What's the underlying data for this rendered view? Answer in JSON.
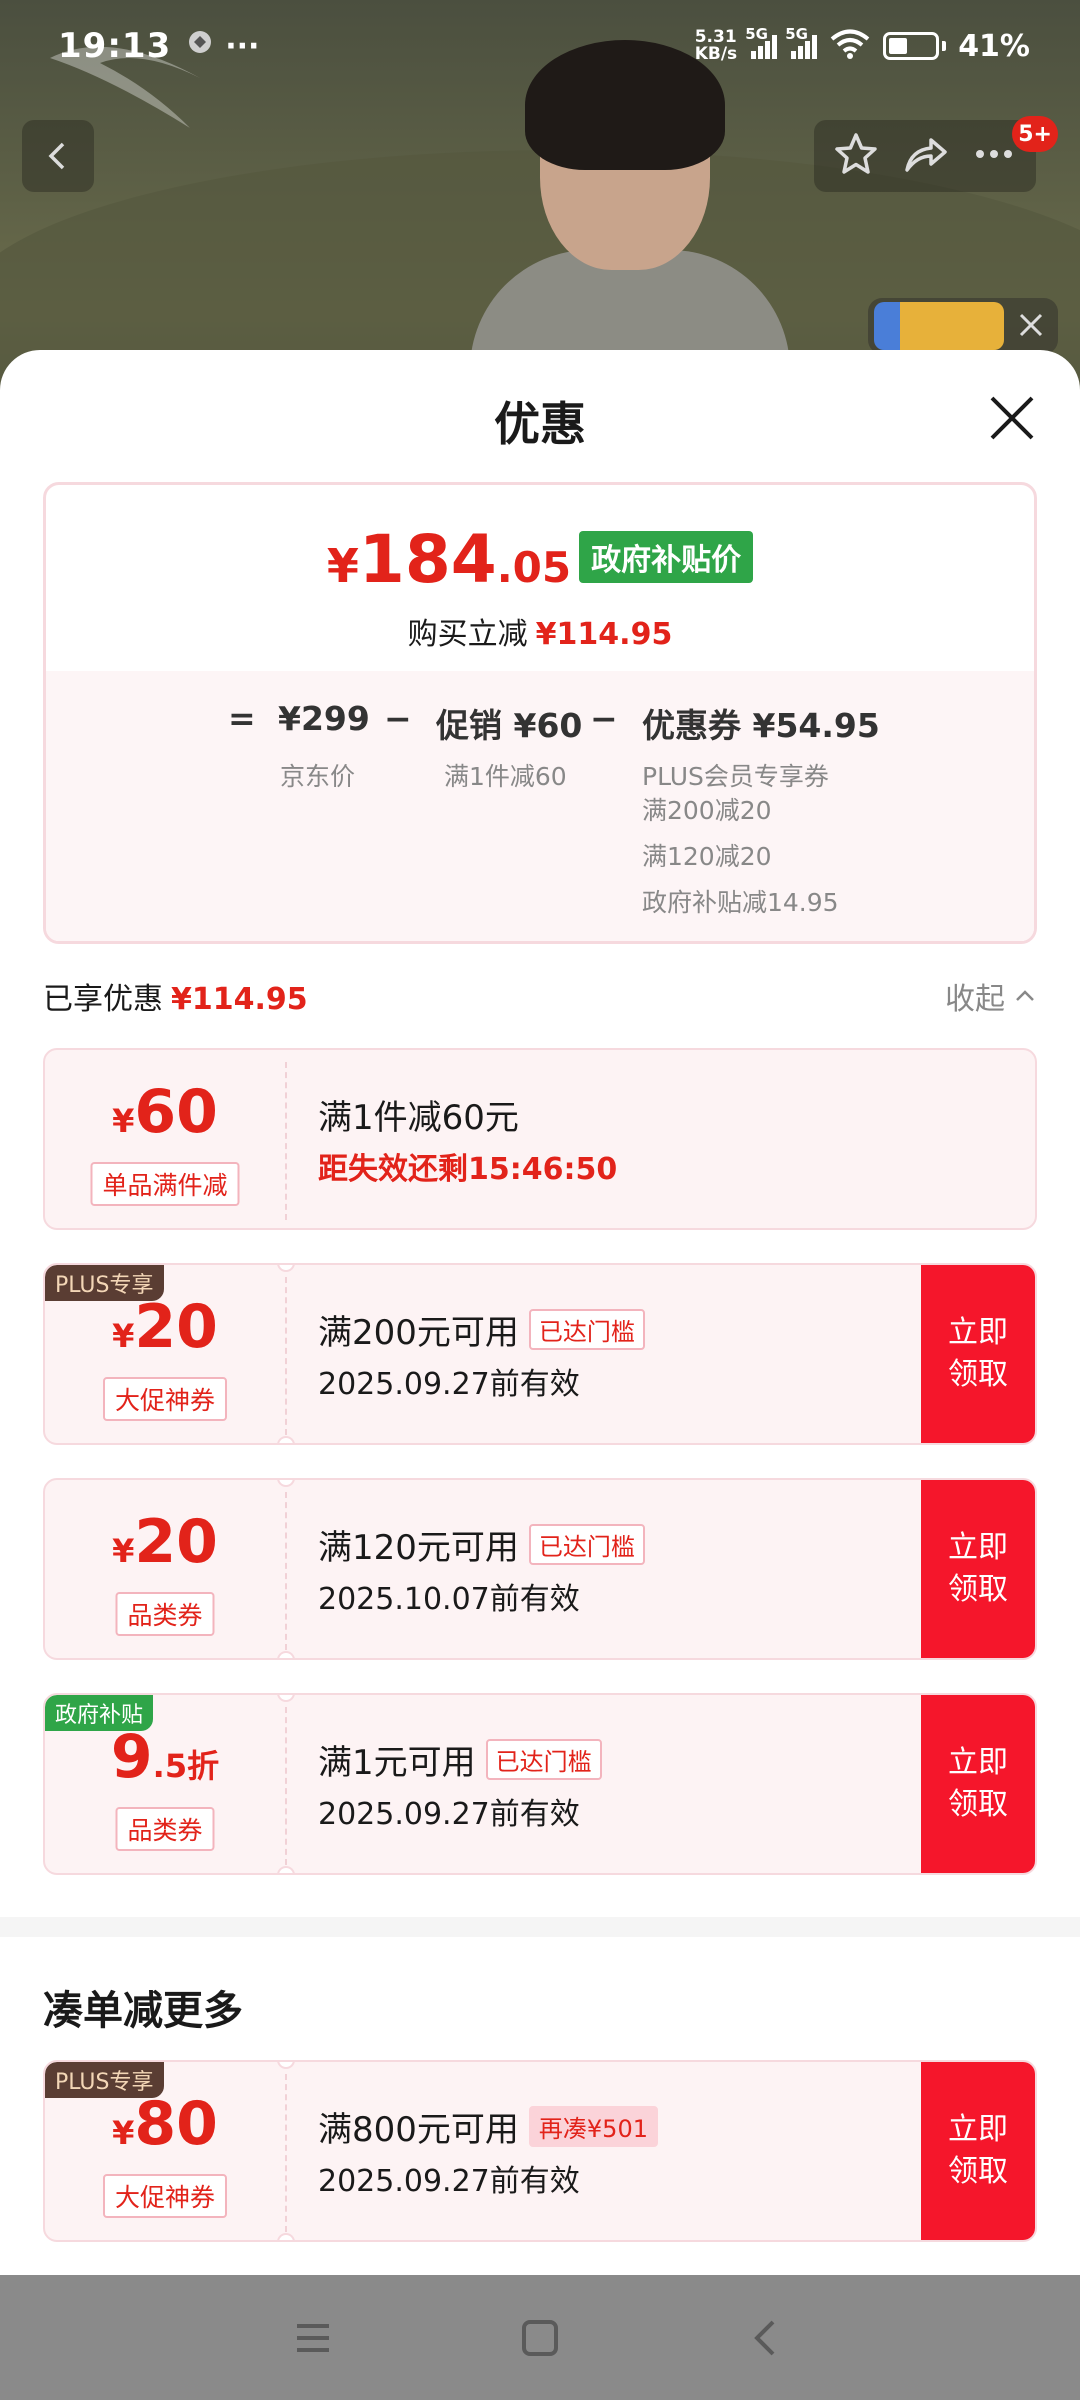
{
  "status_bar": {
    "time": "19:13",
    "net_speed_top": "5.31",
    "net_speed_bottom": "KB/s",
    "sim1_label": "5G",
    "sim2_label": "5G",
    "battery_level": 0.41,
    "battery_text": "41%",
    "more_dots": "···"
  },
  "top_nav": {
    "badge": "5+"
  },
  "sheet": {
    "title": "优惠"
  },
  "summary": {
    "price_symbol": "¥",
    "price_integer": "184",
    "price_decimal": ".05",
    "gov_price_tag": "政府补贴价",
    "reduce_label": "购买立减",
    "reduce_value": "¥114.95",
    "equals": "=",
    "base_price": "¥299",
    "minus1": "−",
    "promo": "促销 ¥60",
    "minus2": "−",
    "coupon_total": "优惠券 ¥54.95",
    "base_label": "京东价",
    "promo_detail": "满1件减60",
    "coupon_details": [
      "PLUS会员专享券",
      "满200减20",
      "满120减20",
      "政府补贴减14.95"
    ]
  },
  "enjoyed": {
    "label": "已享优惠",
    "value": "¥114.95",
    "collapse_label": "收起"
  },
  "coupons": [
    {
      "corner": "",
      "amount_symbol": "¥",
      "amount": "60",
      "type": "单品满件减",
      "condition": "满1件减60元",
      "tag": "",
      "expire": "距失效还剩15:46:50",
      "claim": ""
    },
    {
      "corner": "PLUS专享",
      "amount_symbol": "¥",
      "amount": "20",
      "type": "大促神券",
      "condition": "满200元可用",
      "tag": "已达门槛",
      "expire": "2025.09.27前有效",
      "claim": "立即\n领取"
    },
    {
      "corner": "",
      "amount_symbol": "¥",
      "amount": "20",
      "type": "品类券",
      "condition": "满120元可用",
      "tag": "已达门槛",
      "expire": "2025.10.07前有效",
      "claim": "立即\n领取"
    },
    {
      "corner": "政府补贴",
      "amount_symbol": "",
      "amount": "9",
      "amount_suffix": ".5折",
      "type": "品类券",
      "condition": "满1元可用",
      "tag": "已达门槛",
      "expire": "2025.09.27前有效",
      "claim": "立即\n领取"
    }
  ],
  "more_section": {
    "title": "凑单减更多",
    "coupon": {
      "corner": "PLUS专享",
      "amount_symbol": "¥",
      "amount": "80",
      "type": "大促神券",
      "condition": "满800元可用",
      "tag": "再凑¥501",
      "expire": "2025.09.27前有效",
      "claim": "立即\n领取"
    }
  },
  "colors": {
    "accent_red": "#e2231a",
    "claim_red": "#f5162b",
    "gov_green": "#2fa548",
    "plus_brown": "#5a3d33"
  },
  "icons": [
    "back-arrow-icon",
    "star-icon",
    "share-icon",
    "more-icon",
    "close-icon",
    "chevron-up-icon",
    "menu-icon",
    "home-square-icon",
    "back-nav-icon",
    "wifi-icon",
    "battery-icon",
    "signal-icon"
  ]
}
